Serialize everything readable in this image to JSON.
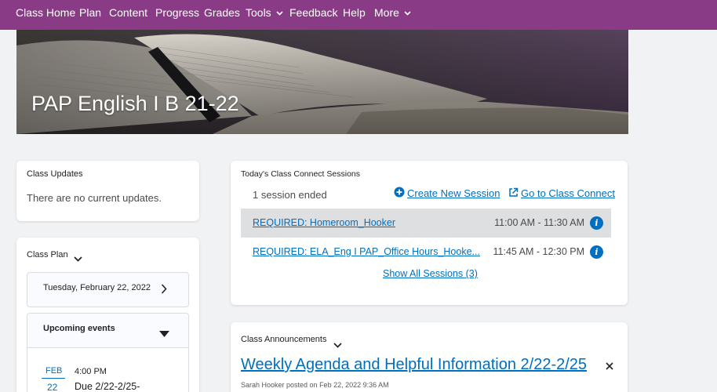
{
  "nav": {
    "items": [
      {
        "label": "Class Home"
      },
      {
        "label": "Plan"
      },
      {
        "label": "Content"
      },
      {
        "label": "Progress"
      },
      {
        "label": "Grades"
      },
      {
        "label": "Tools",
        "dropdown": true
      },
      {
        "label": "Feedback"
      },
      {
        "label": "Help"
      },
      {
        "label": "More",
        "dropdown": true
      }
    ]
  },
  "banner": {
    "title": "PAP English I B 21-22"
  },
  "class_updates": {
    "heading": "Class Updates",
    "message": "There are no current updates."
  },
  "class_plan": {
    "heading": "Class Plan",
    "date": "Tuesday, February 22, 2022",
    "upcoming_title": "Upcoming events",
    "event": {
      "month": "FEB",
      "day": "22",
      "time": "4:00 PM",
      "title": "Due 2/22-2/25-"
    }
  },
  "sessions": {
    "heading": "Today's Class Connect Sessions",
    "ended_text": "1 session ended",
    "create_label": "Create New Session",
    "goto_label": "Go to Class Connect",
    "rows": [
      {
        "title": "REQUIRED: Homeroom_Hooker",
        "time": "11:00 AM - 11:30 AM"
      },
      {
        "title": "REQUIRED: ELA_Eng I PAP_Office Hours_Hooke...",
        "time": "11:45 AM - 12:30 PM"
      }
    ],
    "show_all_label": "Show All Sessions (3)"
  },
  "announcements": {
    "heading": "Class Announcements",
    "title": "Weekly Agenda and Helpful Information 2/22-2/25",
    "meta": "Sarah Hooker posted on Feb 22, 2022 9:36 AM"
  },
  "colors": {
    "nav_bg": "#8a3b86",
    "link": "#006fbf",
    "page_bg": "#f1f2f3"
  }
}
